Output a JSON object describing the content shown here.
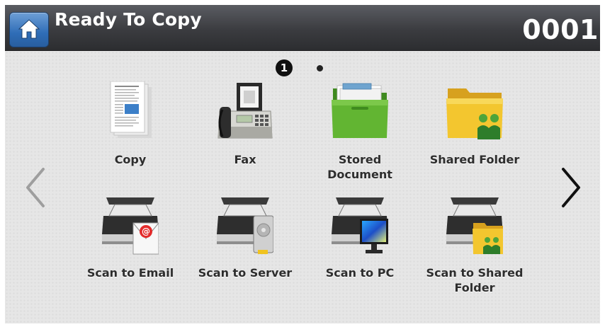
{
  "header": {
    "title": "Ready To Copy",
    "copy_count": "0001",
    "home_icon": "home-icon"
  },
  "pagination": {
    "current_page": "1",
    "total_pages": 2
  },
  "navigation": {
    "prev_icon": "chevron-left-icon",
    "next_icon": "chevron-right-icon"
  },
  "apps": [
    {
      "label": "Copy",
      "icon": "copy-document-icon"
    },
    {
      "label": "Fax",
      "icon": "fax-machine-icon"
    },
    {
      "label": "Stored Document",
      "icon": "green-folder-icon"
    },
    {
      "label": "Shared Folder",
      "icon": "shared-folder-icon"
    },
    {
      "label": "Scan to Email",
      "icon": "scan-email-icon"
    },
    {
      "label": "Scan to Server",
      "icon": "scan-server-icon"
    },
    {
      "label": "Scan to PC",
      "icon": "scan-pc-icon"
    },
    {
      "label": "Scan to Shared Folder",
      "icon": "scan-shared-folder-icon"
    }
  ],
  "colors": {
    "header_bg": "#3b3c40",
    "home_button": "#2f6db7",
    "stored_folder": "#5cae2e",
    "shared_folder": "#f2c22c"
  }
}
